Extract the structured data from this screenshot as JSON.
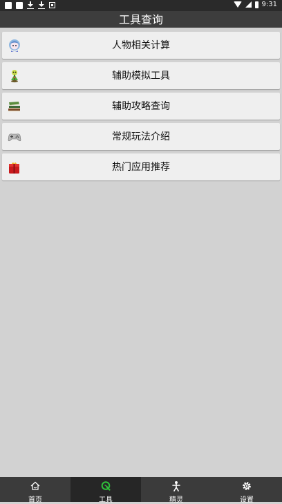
{
  "status_bar": {
    "time": "9:31"
  },
  "header": {
    "title": "工具查询"
  },
  "menu": {
    "items": [
      {
        "label": "人物相关计算",
        "icon": "character-avatar-icon"
      },
      {
        "label": "辅助模拟工具",
        "icon": "sprout-creature-icon"
      },
      {
        "label": "辅助攻略查询",
        "icon": "book-stack-icon"
      },
      {
        "label": "常规玩法介绍",
        "icon": "gamepad-icon"
      },
      {
        "label": "热门应用推荐",
        "icon": "red-gift-box-icon"
      }
    ]
  },
  "bottom_nav": {
    "active_index": 1,
    "active_color": "#2fbf3a",
    "tabs": [
      {
        "label": "首页",
        "icon": "home-icon"
      },
      {
        "label": "工具",
        "icon": "tool-q-icon"
      },
      {
        "label": "精灵",
        "icon": "sprite-figure-icon"
      },
      {
        "label": "设置",
        "icon": "gear-icon"
      }
    ]
  }
}
